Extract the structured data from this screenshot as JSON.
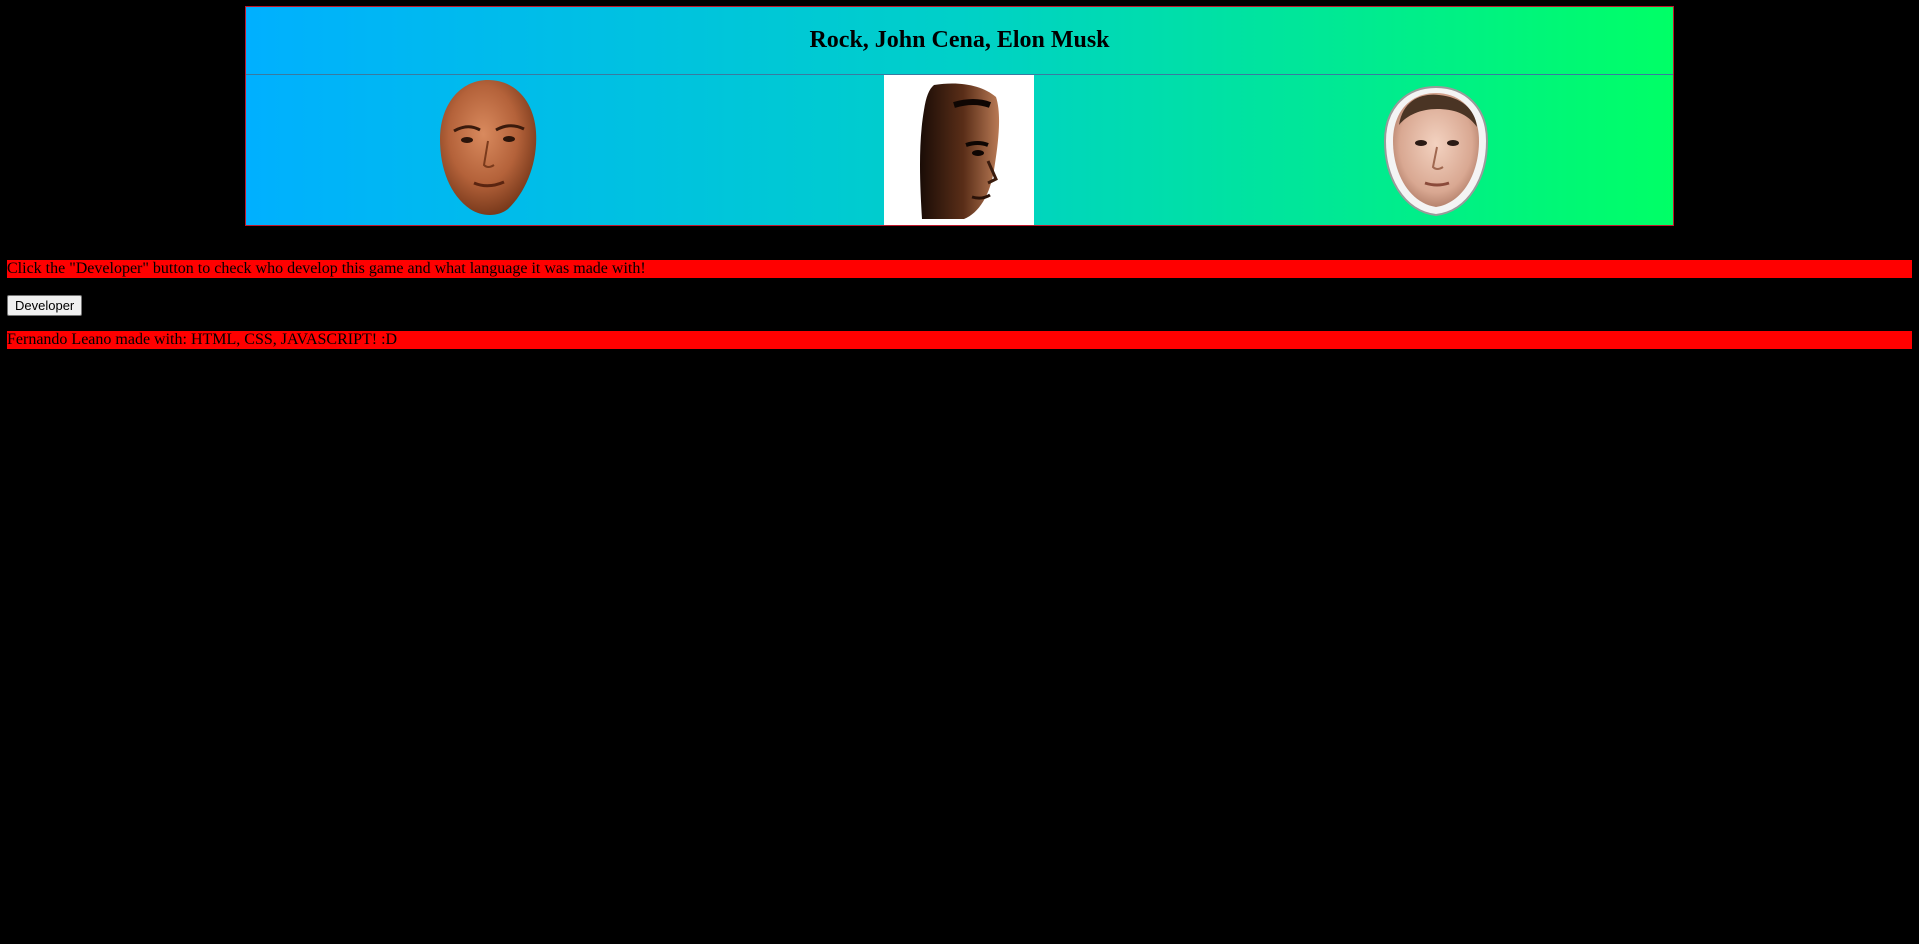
{
  "banner": {
    "title": "Rock, John Cena, Elon Musk",
    "faces": [
      {
        "icon": "rock-face-icon"
      },
      {
        "icon": "john-cena-face-icon"
      },
      {
        "icon": "elon-musk-face-icon"
      }
    ],
    "colors": {
      "gradient_start": "#00b0ff",
      "gradient_end": "#00ff66",
      "border": "#c0162b"
    }
  },
  "instructions": "Click the \"Developer\" button to check who develop this game and what language it was made with!",
  "developer_button": {
    "label": "Developer"
  },
  "credits": "Fernando Leano made with: HTML, CSS, JAVASCRIPT! :D",
  "colors": {
    "page_background": "#000000",
    "message_bar": "#ff0000"
  }
}
